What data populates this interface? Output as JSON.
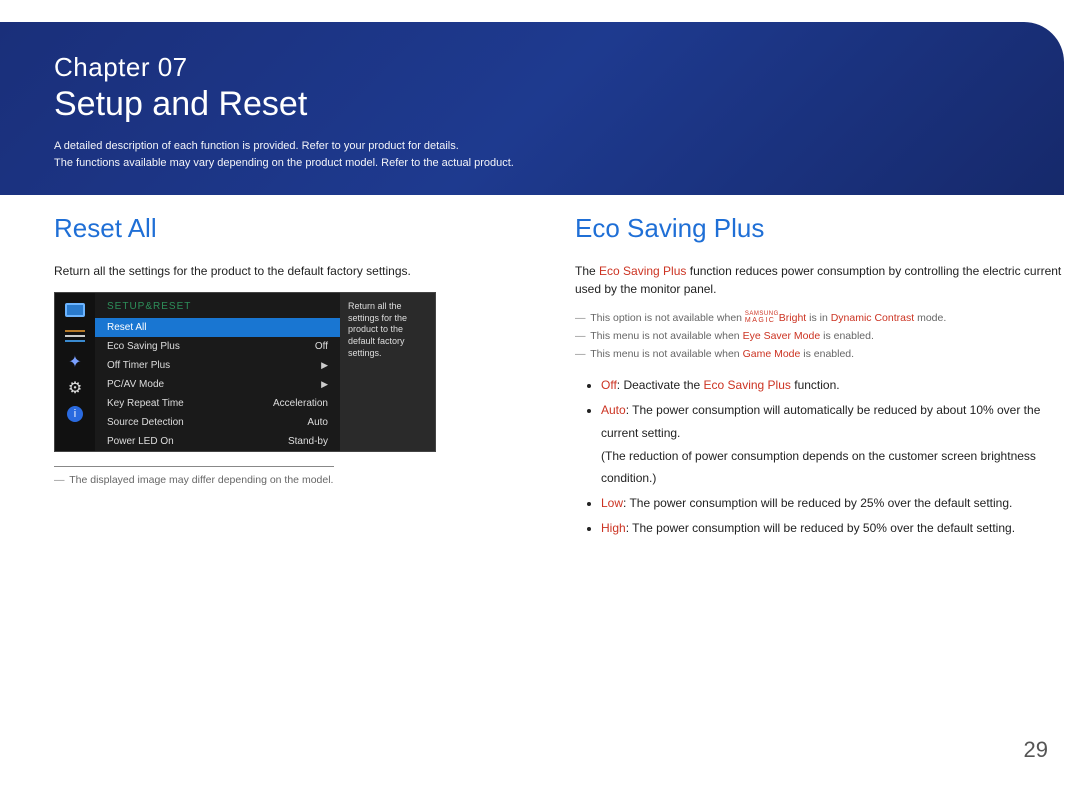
{
  "header": {
    "chapter_line": "Chapter 07",
    "chapter_title": "Setup and Reset",
    "desc_line1": "A detailed description of each function is provided. Refer to your product for details.",
    "desc_line2": "The functions available may vary depending on the product model. Refer to the actual product."
  },
  "left": {
    "heading": "Reset All",
    "body": "Return all the settings for the product to the default factory settings.",
    "osd": {
      "title": "SETUP&RESET",
      "rows": [
        {
          "label": "Reset All",
          "value": "",
          "selected": true
        },
        {
          "label": "Eco Saving Plus",
          "value": "Off"
        },
        {
          "label": "Off Timer Plus",
          "value": "",
          "arrow": true
        },
        {
          "label": "PC/AV Mode",
          "value": "",
          "arrow": true
        },
        {
          "label": "Key Repeat Time",
          "value": "Acceleration"
        },
        {
          "label": "Source Detection",
          "value": "Auto"
        },
        {
          "label": "Power LED On",
          "value": "Stand-by"
        }
      ],
      "desc": "Return all the settings for the product to the default factory settings."
    },
    "footnote": "The displayed image may differ depending on the model."
  },
  "right": {
    "heading": "Eco Saving Plus",
    "intro_pre": "The ",
    "intro_em": "Eco Saving Plus",
    "intro_post": " function reduces power consumption by controlling the electric current used by the monitor panel.",
    "note1_pre": "This option is not available when ",
    "note1_magic_top": "SAMSUNG",
    "note1_magic_bot": "MAGIC",
    "note1_bright": "Bright",
    "note1_mid": " is in ",
    "note1_mode": "Dynamic Contrast",
    "note1_post": " mode.",
    "note2_pre": "This menu is not available when ",
    "note2_mode": "Eye Saver Mode",
    "note2_post": " is enabled.",
    "note3_pre": "This menu is not available when ",
    "note3_mode": "Game Mode",
    "note3_post": " is enabled.",
    "bullets": {
      "off_label": "Off",
      "off_text": ": Deactivate the ",
      "off_em": "Eco Saving Plus",
      "off_post": " function.",
      "auto_label": "Auto",
      "auto_text": ": The power consumption will automatically be reduced by about 10% over the current setting.",
      "auto_sub": "(The reduction of power consumption depends on the customer screen brightness condition.)",
      "low_label": "Low",
      "low_text": ": The power consumption will be reduced by 25% over the default setting.",
      "high_label": "High",
      "high_text": ": The power consumption will be reduced by 50% over the default setting."
    }
  },
  "page_number": "29"
}
